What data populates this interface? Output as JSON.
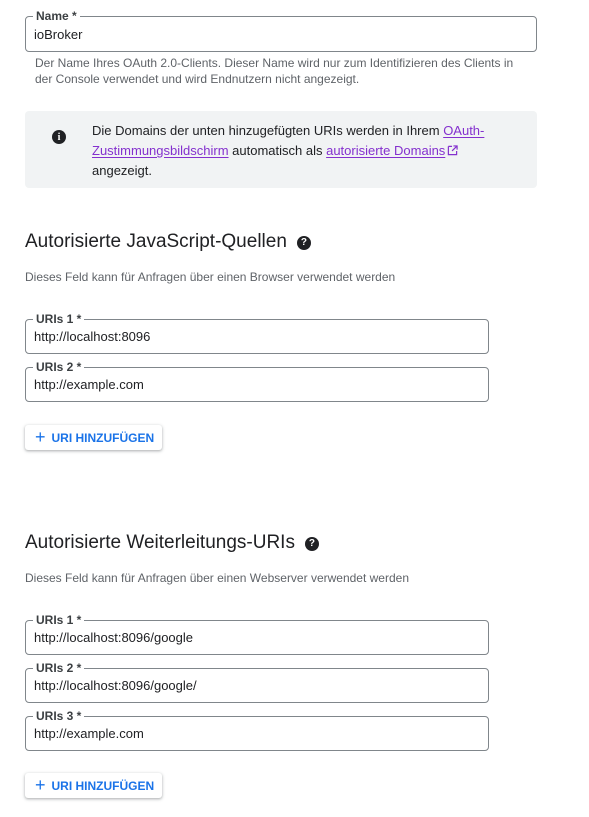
{
  "name_field": {
    "label": "Name *",
    "value": "ioBroker"
  },
  "name_hint": "Der Name Ihres OAuth 2.0-Clients. Dieser Name wird nur zum Identifizieren des Clients in der Console verwendet und wird Endnutzern nicht angezeigt.",
  "info": {
    "text_before": "Die Domains der unten hinzugefügten URIs werden in Ihrem ",
    "link1": "OAuth-Zustimmungsbildschirm",
    "text_middle": " automatisch als ",
    "link2": "autorisierte Domains",
    "text_after": " angezeigt."
  },
  "js_section": {
    "title": "Autorisierte JavaScript-Quellen",
    "description": "Dieses Feld kann für Anfragen über einen Browser verwendet werden",
    "uris": [
      {
        "label": "URIs 1 *",
        "value": "http://localhost:8096"
      },
      {
        "label": "URIs 2 *",
        "value": "http://example.com"
      }
    ],
    "add_label": "URI HINZUFÜGEN"
  },
  "redirect_section": {
    "title": "Autorisierte Weiterleitungs-URIs",
    "description": "Dieses Feld kann für Anfragen über einen Webserver verwendet werden",
    "uris": [
      {
        "label": "URIs 1 *",
        "value": "http://localhost:8096/google"
      },
      {
        "label": "URIs 2 *",
        "value": "http://localhost:8096/google/"
      },
      {
        "label": "URIs 3 *",
        "value": "http://example.com"
      }
    ],
    "add_label": "URI HINZUFÜGEN"
  },
  "colors": {
    "link": "#8430ce",
    "accent": "#1a73e8",
    "info_bg": "#f1f3f4"
  },
  "icons": {
    "info": "info-icon",
    "help": "help-icon",
    "external": "external-link-icon",
    "add": "plus-icon"
  }
}
